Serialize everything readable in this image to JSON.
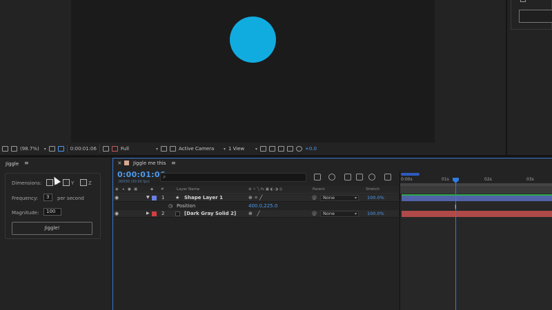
{
  "viewer_toolbar": {
    "zoom": "(98.7%)",
    "timecode": "0:00:01:06",
    "resolution": "Full",
    "camera": "Active Camera",
    "views": "1 View",
    "exposure": "+0.0"
  },
  "jiggle_panel": {
    "title": "Jiggle",
    "menu_icon": "≡",
    "dimensions_label": "Dimensions:",
    "dim_x": "X",
    "dim_y": "Y",
    "dim_z": "Z",
    "frequency_label": "Frequency:",
    "frequency_value": "3",
    "frequency_unit": "per second",
    "magnitude_label": "Magnitude:",
    "magnitude_value": "100",
    "button_label": "Jiggle!"
  },
  "timeline": {
    "close_icon": "×",
    "comp_name": "Jiggle me this",
    "menu_icon": "≡",
    "timecode": "0:00:01:06",
    "fps": "00030 (30.00 fps)",
    "columns": {
      "hash": "#",
      "layer_name": "Layer Name",
      "parent": "Parent",
      "stretch": "Stretch"
    },
    "ruler_ticks": [
      "0:00s",
      "01s",
      "02s",
      "03s"
    ],
    "layers": [
      {
        "number": "1",
        "name": "Shape Layer 1",
        "star": "★",
        "twirl": "▼",
        "label_color": "#6a7fe0",
        "parent": "None",
        "stretch": "100.0%"
      },
      {
        "number": "2",
        "name": "[Dark Gray Solid 2]",
        "twirl": "▶",
        "label_color": "#d23f3f",
        "parent": "None",
        "stretch": "100.0%"
      }
    ],
    "position_property": {
      "name": "Position",
      "value": "400.0,225.0"
    }
  },
  "colors": {
    "accent_blue": "#4d9bf0",
    "circle": "#10ace0",
    "track_shape": "#5163a8",
    "track_solid": "#b04a48"
  }
}
